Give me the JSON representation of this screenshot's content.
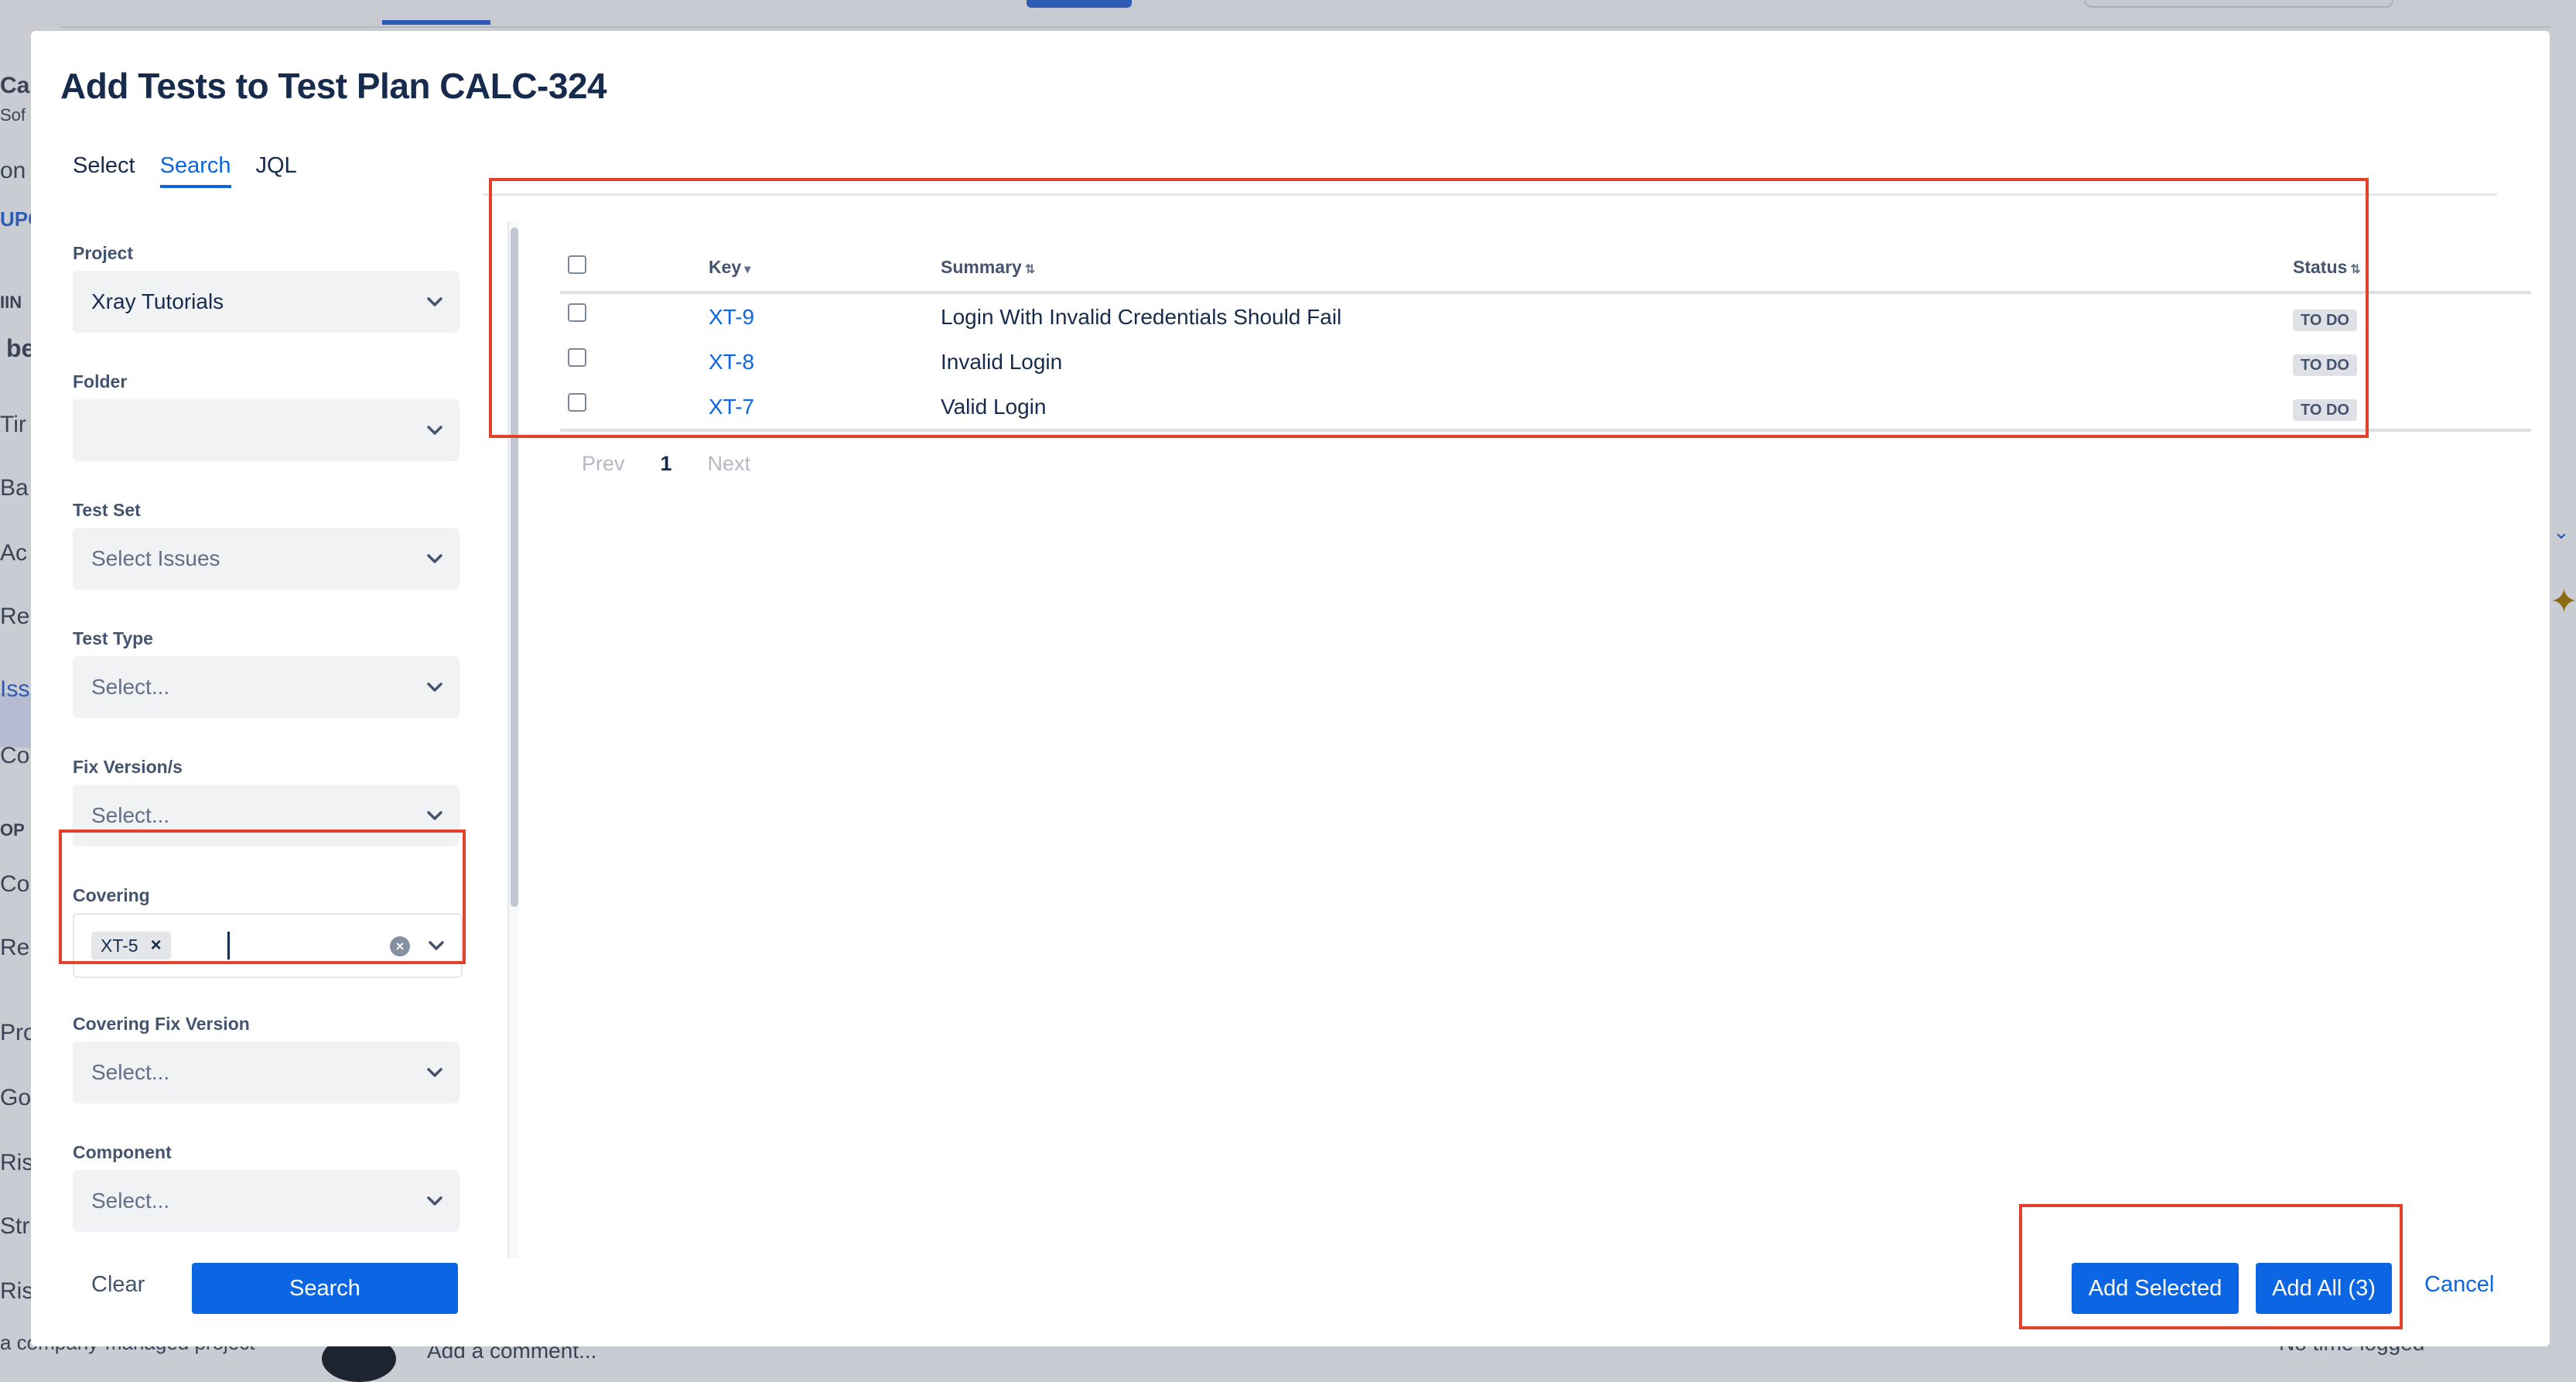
{
  "dialog": {
    "title": "Add Tests to Test Plan CALC-324"
  },
  "tabs": [
    {
      "label": "Select",
      "active": false
    },
    {
      "label": "Search",
      "active": true
    },
    {
      "label": "JQL",
      "active": false
    }
  ],
  "filters": {
    "project": {
      "label": "Project",
      "value": "Xray Tutorials"
    },
    "folder": {
      "label": "Folder",
      "value": ""
    },
    "test_set": {
      "label": "Test Set",
      "placeholder": "Select Issues"
    },
    "test_type": {
      "label": "Test Type",
      "placeholder": "Select..."
    },
    "fix_version": {
      "label": "Fix Version/s",
      "placeholder": "Select..."
    },
    "covering": {
      "label": "Covering",
      "tags": [
        "XT-5"
      ],
      "tag_remove": "×"
    },
    "covering_fix_version": {
      "label": "Covering Fix Version",
      "placeholder": "Select..."
    },
    "component": {
      "label": "Component",
      "placeholder": "Select..."
    }
  },
  "results": {
    "columns": [
      "Key",
      "Summary",
      "Status"
    ],
    "rows": [
      {
        "key": "XT-9",
        "summary": "Login With Invalid Credentials Should Fail",
        "status": "TO DO"
      },
      {
        "key": "XT-8",
        "summary": "Invalid Login",
        "status": "TO DO"
      },
      {
        "key": "XT-7",
        "summary": "Valid Login",
        "status": "TO DO"
      }
    ],
    "pager": {
      "prev": "Prev",
      "page": "1",
      "next": "Next"
    }
  },
  "footer": {
    "clear_label": "Clear",
    "search_label": "Search",
    "add_selected_label": "Add Selected",
    "add_all_label": "Add All (3)",
    "cancel_label": "Cancel"
  },
  "background": {
    "left_fragments": [
      "Cal",
      "Sof",
      "on",
      "UPC",
      "IIN",
      "be",
      "Tir",
      "Ba",
      "Ac",
      "Re",
      "Iss",
      "Co",
      "OP",
      "Co",
      "Re",
      "Pro",
      "Go",
      "Ris",
      "Str",
      "Ris"
    ],
    "footer_left": "a company-managed project",
    "comment_placeholder": "Add a comment...",
    "time_logged": "No time logged"
  },
  "colors": {
    "primary": "#0c66e4",
    "annotation": "#e5402c",
    "overlay": "#c9ccd2"
  }
}
